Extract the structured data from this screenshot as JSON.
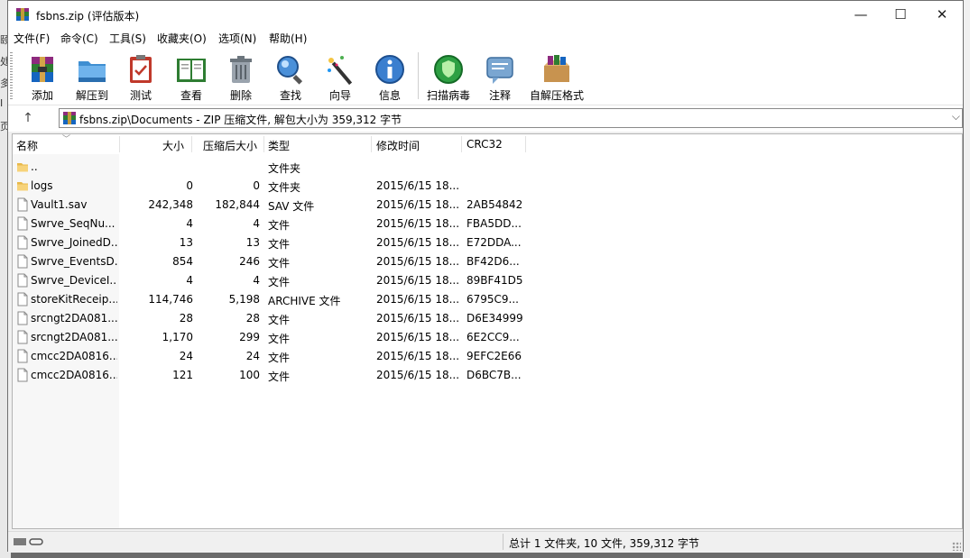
{
  "window": {
    "title": "fsbns.zip (评估版本)",
    "controls": [
      "—",
      "☐",
      "✕"
    ]
  },
  "menu": [
    "文件(F)",
    "命令(C)",
    "工具(S)",
    "收藏夹(O)",
    "选项(N)",
    "帮助(H)"
  ],
  "toolbar": {
    "buttons": [
      {
        "label": "添加",
        "icon": "add-archive-icon"
      },
      {
        "label": "解压到",
        "icon": "extract-folder-icon"
      },
      {
        "label": "测试",
        "icon": "test-clipboard-icon"
      },
      {
        "label": "查看",
        "icon": "view-book-icon"
      },
      {
        "label": "删除",
        "icon": "delete-trash-icon"
      },
      {
        "label": "查找",
        "icon": "find-magnifier-icon"
      },
      {
        "label": "向导",
        "icon": "wizard-wand-icon"
      },
      {
        "label": "信息",
        "icon": "info-icon"
      },
      {
        "label": "扫描病毒",
        "icon": "virus-scan-icon"
      },
      {
        "label": "注释",
        "icon": "comment-icon"
      },
      {
        "label": "自解压格式",
        "icon": "sfx-box-icon"
      }
    ]
  },
  "address": {
    "up_arrow": "↑",
    "path": "fsbns.zip\\Documents - ZIP 压缩文件, 解包大小为 359,312 字节",
    "dropdown": "⌵"
  },
  "columns": {
    "name": "名称",
    "size": "大小",
    "packed": "压缩后大小",
    "type": "类型",
    "modified": "修改时间",
    "crc": "CRC32"
  },
  "rows": [
    {
      "name": "..",
      "size": "",
      "packed": "",
      "type": "文件夹",
      "modified": "",
      "crc": "",
      "kind": "folder"
    },
    {
      "name": "logs",
      "size": "0",
      "packed": "0",
      "type": "文件夹",
      "modified": "2015/6/15 18...",
      "crc": "",
      "kind": "folder"
    },
    {
      "name": "Vault1.sav",
      "size": "242,348",
      "packed": "182,844",
      "type": "SAV 文件",
      "modified": "2015/6/15 18...",
      "crc": "2AB54842",
      "kind": "file"
    },
    {
      "name": "Swrve_SeqNu...",
      "size": "4",
      "packed": "4",
      "type": "文件",
      "modified": "2015/6/15 18...",
      "crc": "FBA5DD...",
      "kind": "file"
    },
    {
      "name": "Swrve_JoinedD...",
      "size": "13",
      "packed": "13",
      "type": "文件",
      "modified": "2015/6/15 18...",
      "crc": "E72DDA...",
      "kind": "file"
    },
    {
      "name": "Swrve_EventsD...",
      "size": "854",
      "packed": "246",
      "type": "文件",
      "modified": "2015/6/15 18...",
      "crc": "BF42D6...",
      "kind": "file"
    },
    {
      "name": "Swrve_DeviceI...",
      "size": "4",
      "packed": "4",
      "type": "文件",
      "modified": "2015/6/15 18...",
      "crc": "89BF41D5",
      "kind": "file"
    },
    {
      "name": "storeKitReceip...",
      "size": "114,746",
      "packed": "5,198",
      "type": "ARCHIVE 文件",
      "modified": "2015/6/15 18...",
      "crc": "6795C9...",
      "kind": "file"
    },
    {
      "name": "srcngt2DA081...",
      "size": "28",
      "packed": "28",
      "type": "文件",
      "modified": "2015/6/15 18...",
      "crc": "D6E34999",
      "kind": "file"
    },
    {
      "name": "srcngt2DA081...",
      "size": "1,170",
      "packed": "299",
      "type": "文件",
      "modified": "2015/6/15 18...",
      "crc": "6E2CC9...",
      "kind": "file"
    },
    {
      "name": "cmcc2DA0816...",
      "size": "24",
      "packed": "24",
      "type": "文件",
      "modified": "2015/6/15 18...",
      "crc": "9EFC2E66",
      "kind": "file"
    },
    {
      "name": "cmcc2DA0816...",
      "size": "121",
      "packed": "100",
      "type": "文件",
      "modified": "2015/6/15 18...",
      "crc": "D6BC7B...",
      "kind": "file"
    }
  ],
  "status": {
    "summary": "总计 1 文件夹, 10 文件, 359,312 字节"
  },
  "desktop": {
    "edge_chars": [
      "颐",
      "处",
      "多",
      "I",
      "页"
    ]
  }
}
